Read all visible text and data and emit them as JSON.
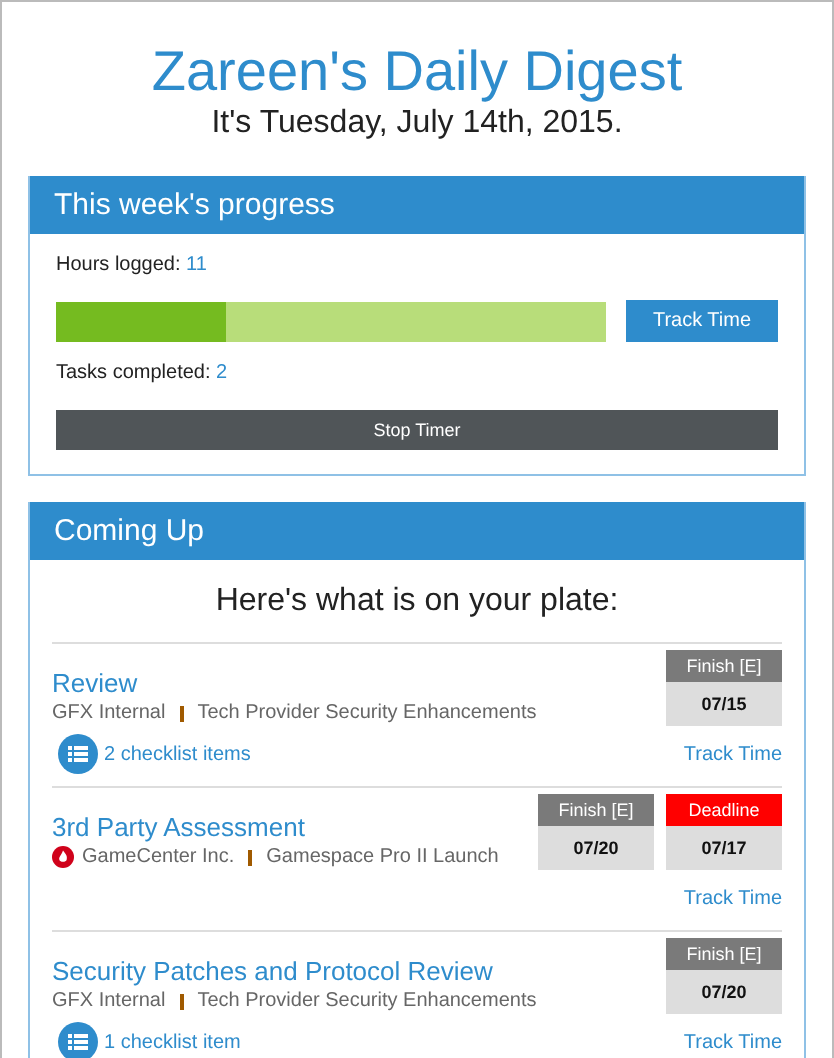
{
  "header": {
    "title": "Zareen's Daily Digest",
    "date": "It's Tuesday, July 14th, 2015."
  },
  "progress": {
    "title": "This week's progress",
    "hours_label": "Hours logged:",
    "hours": "11",
    "level": 0.31,
    "track_button": "Track Time",
    "tasks_label": "Tasks completed:",
    "tasks": "2",
    "stop_button": "Stop Timer"
  },
  "coming_up": {
    "title": "Coming Up",
    "intro": "Here's what is on your plate:",
    "items": [
      {
        "title": "Review",
        "client": "GFX Internal",
        "client_alert": false,
        "project": "Tech Provider Security Enhancements",
        "dates": [
          {
            "kind": "finish",
            "label": "Finish [E]",
            "date": "07/15"
          }
        ],
        "checklist": "2 checklist items",
        "track": "Track Time"
      },
      {
        "title": "3rd Party Assessment",
        "client": "GameCenter Inc.",
        "client_alert": true,
        "project": "Gamespace Pro II Launch",
        "dates": [
          {
            "kind": "finish",
            "label": "Finish [E]",
            "date": "07/20"
          },
          {
            "kind": "deadline",
            "label": "Deadline",
            "date": "07/17"
          }
        ],
        "track": "Track Time"
      },
      {
        "title": "Security Patches and Protocol Review",
        "client": "GFX Internal",
        "client_alert": false,
        "project": "Tech Provider Security Enhancements",
        "dates": [
          {
            "kind": "finish",
            "label": "Finish [E]",
            "date": "07/20"
          }
        ],
        "checklist": "1 checklist item",
        "track": "Track Time"
      }
    ]
  }
}
